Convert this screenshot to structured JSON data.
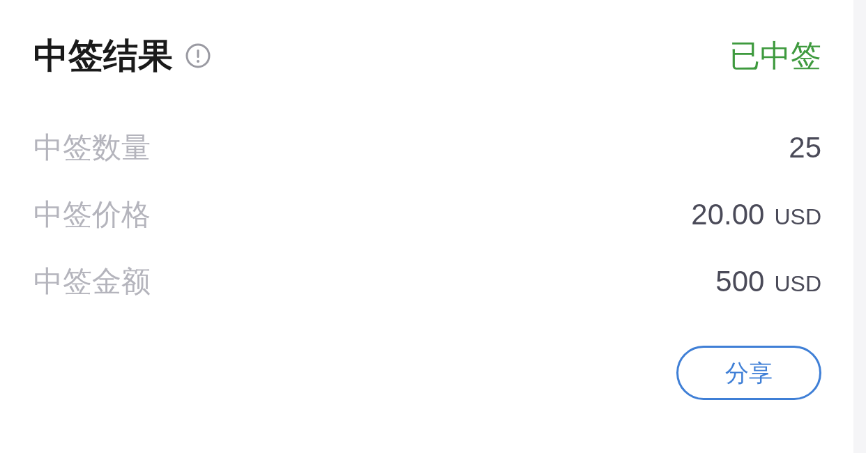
{
  "header": {
    "title": "中签结果",
    "status": "已中签"
  },
  "rows": [
    {
      "label": "中签数量",
      "value": "25"
    },
    {
      "label": "中签价格",
      "value": "20.00",
      "unit": "USD"
    },
    {
      "label": "中签金额",
      "value": "500",
      "unit": "USD"
    }
  ],
  "share_button": {
    "label": "分享"
  }
}
